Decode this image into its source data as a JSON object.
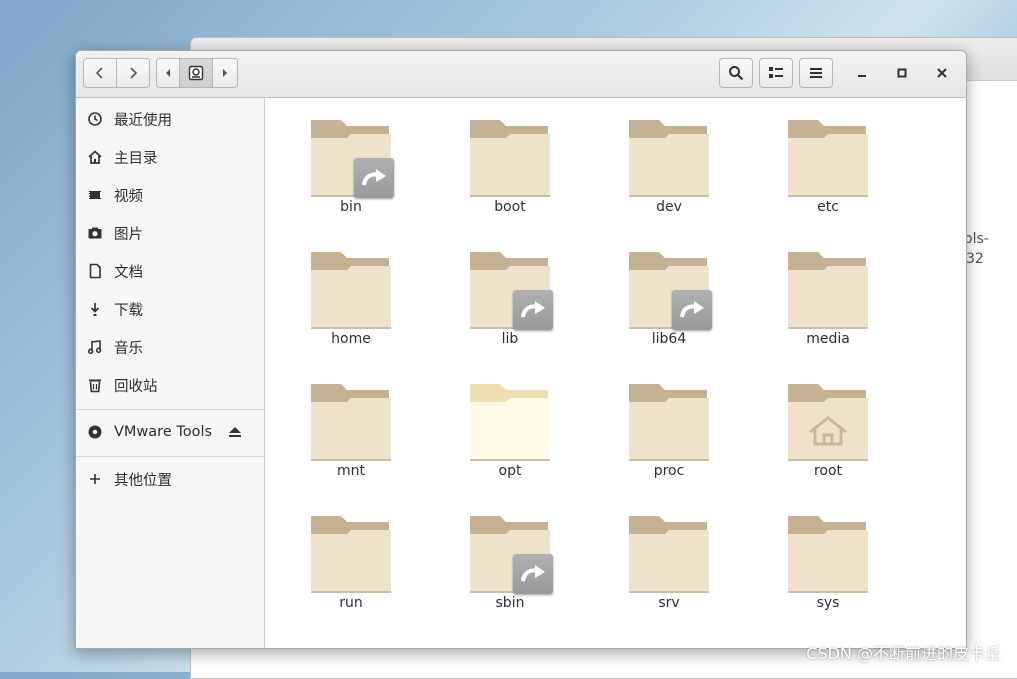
{
  "background_window": {
    "partial_text_1": "ols-",
    "partial_text_2": "32"
  },
  "toolbar": {
    "back_icon": "chevron-left-icon",
    "forward_icon": "chevron-right-icon",
    "path_location_icon": "drive-root-icon",
    "search_icon": "search-icon",
    "view_toggle_icon": "list-view-icon",
    "menu_icon": "hamburger-menu-icon",
    "minimize_icon": "minimize-icon",
    "maximize_icon": "maximize-icon",
    "close_icon": "close-icon"
  },
  "sidebar": {
    "items": [
      {
        "label": "最近使用",
        "icon": "clock-icon"
      },
      {
        "label": "主目录",
        "icon": "home-icon"
      },
      {
        "label": "视频",
        "icon": "video-icon"
      },
      {
        "label": "图片",
        "icon": "camera-icon"
      },
      {
        "label": "文档",
        "icon": "document-icon"
      },
      {
        "label": "下载",
        "icon": "download-icon"
      },
      {
        "label": "音乐",
        "icon": "music-icon"
      },
      {
        "label": "回收站",
        "icon": "trash-icon"
      }
    ],
    "device": {
      "label": "VMware Tools",
      "icon": "disc-icon",
      "eject_icon": "eject-icon"
    },
    "other": {
      "label": "其他位置",
      "icon": "plus-icon"
    }
  },
  "files": [
    {
      "name": "bin",
      "type": "symlink"
    },
    {
      "name": "boot",
      "type": "folder"
    },
    {
      "name": "dev",
      "type": "folder"
    },
    {
      "name": "etc",
      "type": "folder"
    },
    {
      "name": "home",
      "type": "folder"
    },
    {
      "name": "lib",
      "type": "symlink"
    },
    {
      "name": "lib64",
      "type": "symlink"
    },
    {
      "name": "media",
      "type": "folder"
    },
    {
      "name": "mnt",
      "type": "folder"
    },
    {
      "name": "opt",
      "type": "folder-open"
    },
    {
      "name": "proc",
      "type": "folder"
    },
    {
      "name": "root",
      "type": "home-folder"
    },
    {
      "name": "run",
      "type": "folder"
    },
    {
      "name": "sbin",
      "type": "symlink"
    },
    {
      "name": "srv",
      "type": "folder"
    },
    {
      "name": "sys",
      "type": "folder"
    }
  ],
  "watermark": "CSDN @不断前进的皮卡丘",
  "colors": {
    "folder_back": "#c5b294",
    "folder_front": "#eee2cb",
    "symlink_badge": "#9a9a9a"
  }
}
